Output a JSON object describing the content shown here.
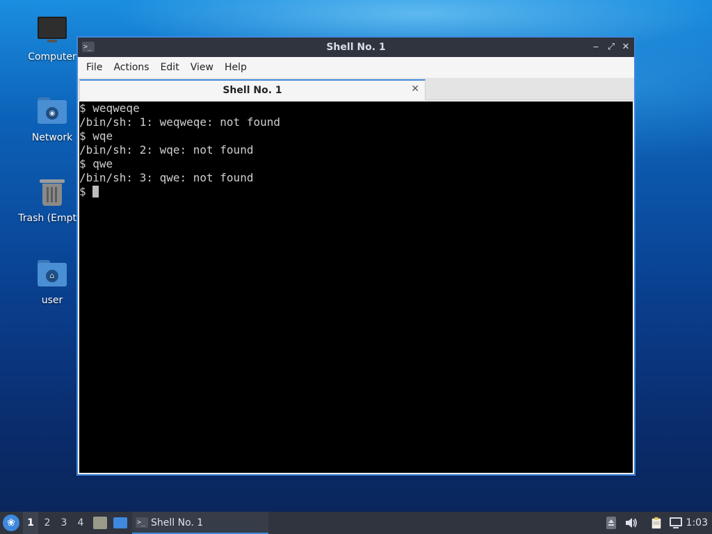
{
  "desktop": {
    "icons": [
      {
        "label": "Computer",
        "icon": "computer-icon"
      },
      {
        "label": "Network",
        "icon": "network-folder-icon"
      },
      {
        "label": "Trash (Empty)",
        "icon": "trash-icon"
      },
      {
        "label": "user",
        "icon": "home-folder-icon"
      }
    ]
  },
  "window": {
    "title": "Shell No. 1",
    "title_icon_glyph": ">_",
    "controls": {
      "minimize": "‒",
      "maximize": "⤢",
      "close": "✕"
    },
    "menu": [
      "File",
      "Actions",
      "Edit",
      "View",
      "Help"
    ],
    "tab": {
      "label": "Shell No. 1",
      "close_glyph": "✕"
    },
    "terminal": {
      "lines": [
        "$ weqweqe",
        "/bin/sh: 1: weqweqe: not found",
        "$ wqe",
        "/bin/sh: 2: wqe: not found",
        "$ qwe",
        "/bin/sh: 3: qwe: not found"
      ],
      "prompt": "$ "
    }
  },
  "taskbar": {
    "start_glyph": "❀",
    "workspaces": [
      "1",
      "2",
      "3",
      "4"
    ],
    "active_workspace": "1",
    "task": {
      "label": "Shell No. 1",
      "icon_glyph": ">_"
    },
    "tray_icons": [
      "eject-icon",
      "volume-icon",
      "clipboard-icon",
      "network-icon"
    ],
    "clock": "1:03"
  },
  "colors": {
    "accent": "#3f88dd",
    "titlebar": "#2f343f",
    "terminal_bg": "#000000",
    "terminal_fg": "#cfcfcf"
  }
}
